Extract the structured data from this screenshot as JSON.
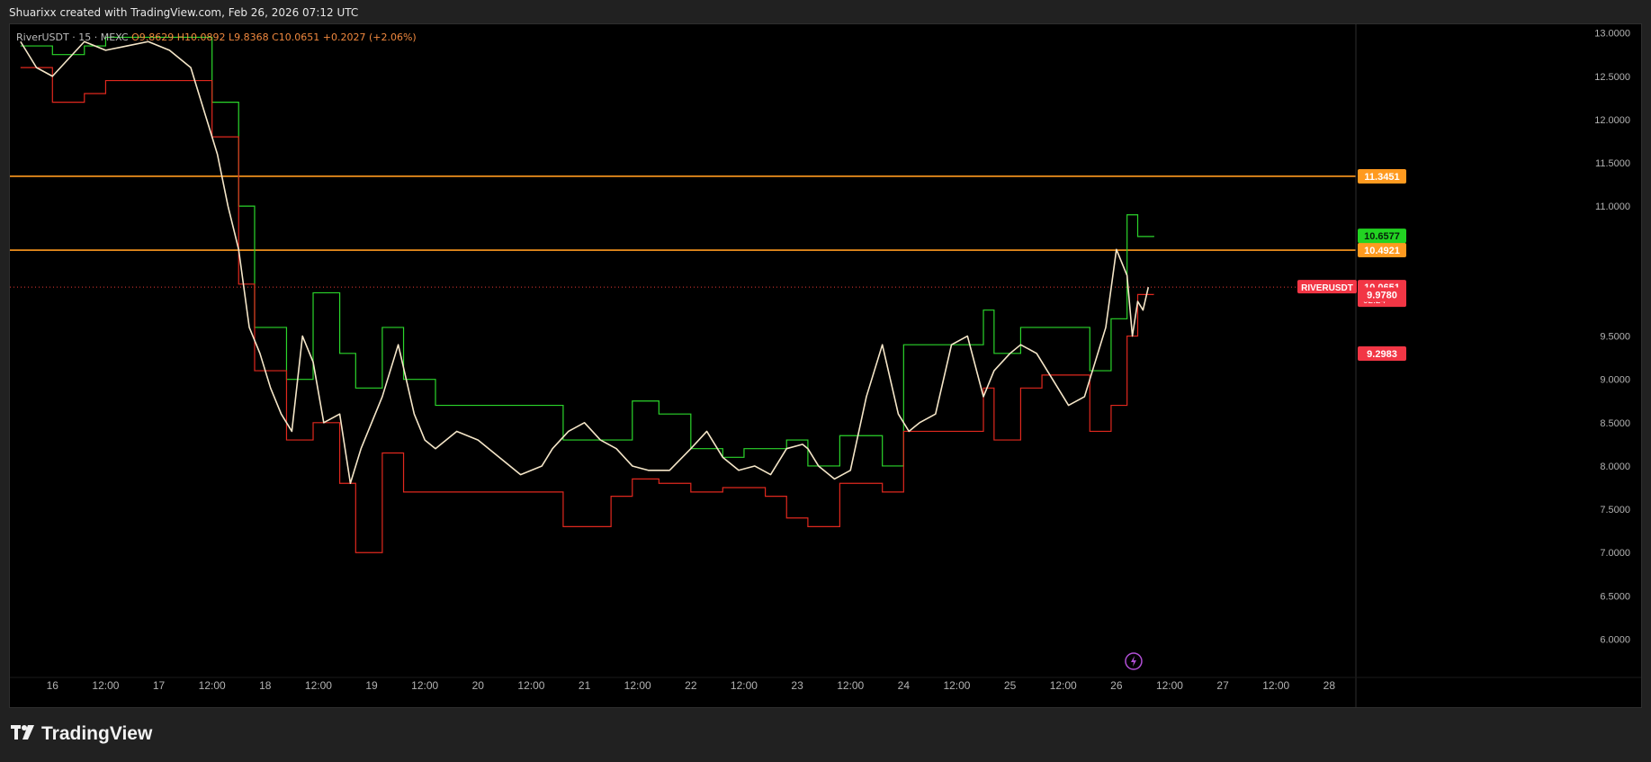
{
  "header": {
    "attribution": "Shuarixx created with TradingView.com, Feb 26, 2026 07:12 UTC"
  },
  "legend": {
    "symbol": "RiverUSDT · 15 · MEXC",
    "open": "O9.8629",
    "high": "H10.0892",
    "low": "L9.8368",
    "close": "C10.0651",
    "change": "+0.2027 (+2.06%)"
  },
  "footer": {
    "brand": "TradingView"
  },
  "colors": {
    "background": "#000000",
    "frame": "#212121",
    "candles": "#f5e6c8",
    "upper_band": "#2bd52b",
    "lower_band": "#e0281e",
    "horizontal_levels": "#ff9a1f",
    "price_line": "#e53935",
    "badge_orange": "#ff9a1f",
    "badge_green": "#22d322",
    "badge_red": "#f23645"
  },
  "chart_data": {
    "type": "line",
    "title": "",
    "symbol": "RIVERUSDT",
    "interval": "15",
    "exchange": "MEXC",
    "x_axis_ticks": [
      "16",
      "12:00",
      "17",
      "12:00",
      "18",
      "12:00",
      "19",
      "12:00",
      "20",
      "12:00",
      "21",
      "12:00",
      "22",
      "12:00",
      "23",
      "12:00",
      "24",
      "12:00",
      "25",
      "12:00",
      "26",
      "12:00",
      "27",
      "12:00",
      "28"
    ],
    "y_axis_ticks": [
      "13.0000",
      "12.5000",
      "12.0000",
      "11.5000",
      "11.0000",
      "9.5000",
      "9.0000",
      "8.5000",
      "8.0000",
      "7.5000",
      "7.0000",
      "6.5000",
      "6.0000"
    ],
    "ylim": [
      5.6,
      13.1
    ],
    "x_unit": "days (Feb 2026)",
    "xlim": [
      15.6,
      28.2
    ],
    "grid": false,
    "horizontal_levels": [
      {
        "label": "11.3451",
        "value": 11.3451
      },
      {
        "label": "10.4921",
        "value": 10.4921
      }
    ],
    "price_badges": [
      {
        "label": "10.6577",
        "value": 10.6577,
        "kind": "upper_band"
      },
      {
        "label": "10.0651",
        "value": 10.0651,
        "kind": "last_price",
        "countdown": "02:24",
        "tag": "RIVERUSDT"
      },
      {
        "label": "9.9780",
        "value": 9.978,
        "kind": "lower_band"
      },
      {
        "label": "9.2983",
        "value": 9.2983,
        "kind": "lower_band"
      }
    ],
    "series": [
      {
        "kind": "price",
        "x": [
          15.7,
          15.85,
          16.0,
          16.15,
          16.3,
          16.5,
          16.7,
          16.9,
          17.1,
          17.3,
          17.45,
          17.55,
          17.65,
          17.75,
          17.85,
          17.95,
          18.05,
          18.15,
          18.25,
          18.35,
          18.45,
          18.55,
          18.7,
          18.8,
          18.9,
          19.0,
          19.1,
          19.25,
          19.4,
          19.5,
          19.6,
          19.8,
          20.0,
          20.2,
          20.4,
          20.6,
          20.7,
          20.85,
          21.0,
          21.15,
          21.3,
          21.45,
          21.6,
          21.8,
          22.0,
          22.15,
          22.3,
          22.45,
          22.6,
          22.75,
          22.9,
          23.05,
          23.1,
          23.2,
          23.35,
          23.5,
          23.65,
          23.8,
          23.95,
          24.05,
          24.15,
          24.3,
          24.45,
          24.6,
          24.75,
          24.85,
          25.0,
          25.1,
          25.25,
          25.4,
          25.55,
          25.7,
          25.8,
          25.9,
          26.0,
          26.1,
          26.15,
          26.2,
          26.25,
          26.3
        ],
        "y": [
          12.9,
          12.6,
          12.5,
          12.7,
          12.9,
          12.8,
          12.85,
          12.9,
          12.8,
          12.6,
          12.0,
          11.6,
          11.0,
          10.5,
          9.6,
          9.3,
          8.9,
          8.6,
          8.4,
          9.5,
          9.2,
          8.5,
          8.6,
          7.8,
          8.2,
          8.5,
          8.8,
          9.4,
          8.6,
          8.3,
          8.2,
          8.4,
          8.3,
          8.1,
          7.9,
          8.0,
          8.2,
          8.4,
          8.5,
          8.3,
          8.2,
          8.0,
          7.95,
          7.95,
          8.2,
          8.4,
          8.1,
          7.95,
          8.0,
          7.9,
          8.2,
          8.25,
          8.2,
          8.0,
          7.85,
          7.95,
          8.8,
          9.4,
          8.6,
          8.4,
          8.5,
          8.6,
          9.4,
          9.5,
          8.8,
          9.1,
          9.3,
          9.4,
          9.3,
          9.0,
          8.7,
          8.8,
          9.2,
          9.6,
          10.5,
          10.2,
          9.5,
          9.9,
          9.8,
          10.0651
        ]
      },
      {
        "kind": "upper_band",
        "x": [
          15.7,
          16.0,
          16.3,
          16.5,
          17.3,
          17.5,
          17.75,
          17.9,
          18.2,
          18.45,
          18.7,
          18.85,
          19.1,
          19.3,
          19.6,
          20.5,
          20.8,
          21.25,
          21.45,
          21.7,
          22.0,
          22.3,
          22.5,
          22.7,
          22.9,
          23.1,
          23.4,
          23.8,
          24.0,
          24.5,
          24.75,
          24.85,
          25.1,
          25.3,
          25.75,
          25.95,
          26.1,
          26.2,
          26.35
        ],
        "y": [
          12.85,
          12.75,
          12.85,
          12.95,
          12.95,
          12.2,
          11.0,
          9.6,
          9.0,
          10.0,
          9.3,
          8.9,
          9.6,
          9.0,
          8.7,
          8.7,
          8.3,
          8.3,
          8.75,
          8.6,
          8.2,
          8.1,
          8.2,
          8.2,
          8.3,
          8.0,
          8.35,
          8.0,
          9.4,
          9.4,
          9.8,
          9.3,
          9.6,
          9.6,
          9.1,
          9.7,
          10.9,
          10.65,
          10.6577
        ]
      },
      {
        "kind": "lower_band",
        "x": [
          15.7,
          16.0,
          16.3,
          16.5,
          17.3,
          17.5,
          17.75,
          17.9,
          18.2,
          18.45,
          18.7,
          18.85,
          19.1,
          19.3,
          19.6,
          20.5,
          20.8,
          21.25,
          21.45,
          21.7,
          22.0,
          22.3,
          22.5,
          22.7,
          22.9,
          23.1,
          23.4,
          23.8,
          24.0,
          24.5,
          24.75,
          24.85,
          25.1,
          25.3,
          25.75,
          25.95,
          26.1,
          26.2,
          26.35
        ],
        "y": [
          12.6,
          12.2,
          12.3,
          12.45,
          12.45,
          11.8,
          10.1,
          9.1,
          8.3,
          8.5,
          7.8,
          7.0,
          8.15,
          7.7,
          7.7,
          7.7,
          7.3,
          7.65,
          7.85,
          7.8,
          7.7,
          7.75,
          7.75,
          7.65,
          7.4,
          7.3,
          7.8,
          7.7,
          8.4,
          8.4,
          8.9,
          8.3,
          8.9,
          9.05,
          8.4,
          8.7,
          9.5,
          9.98,
          9.978
        ]
      }
    ],
    "annotations": [
      "lightning-marker-icon at 26 12:00"
    ]
  }
}
